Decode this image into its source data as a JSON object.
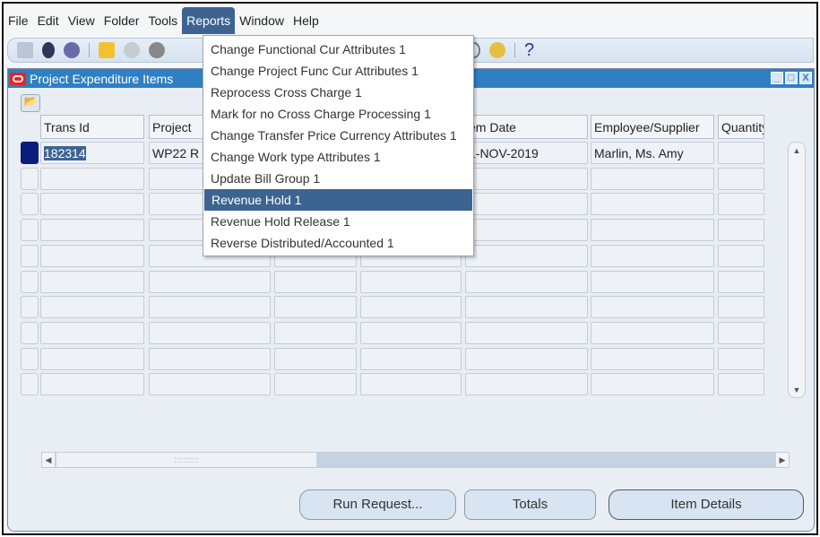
{
  "menubar": [
    "File",
    "Edit",
    "View",
    "Folder",
    "Tools",
    "Reports",
    "Window",
    "Help"
  ],
  "active_menu": "Reports",
  "toolbar": {
    "help_glyph": "?"
  },
  "window": {
    "title": "Project Expenditure Items",
    "controls": [
      "_",
      "□",
      "X"
    ]
  },
  "table": {
    "columns": [
      "Trans Id",
      "Project",
      "",
      "",
      "em Date",
      "Employee/Supplier",
      "Quantity"
    ],
    "rows": [
      [
        "182314",
        "WP22 R",
        "",
        "",
        "1-NOV-2019",
        "Marlin, Ms. Amy",
        ""
      ]
    ],
    "empty_rows": 9
  },
  "reports_menu": {
    "items": [
      "Change Functional Cur Attributes 1",
      "Change Project Func Cur Attributes 1",
      "Reprocess Cross Charge 1",
      "Mark for no Cross Charge Processing 1",
      "Change Transfer Price Currency Attributes 1",
      "Change Work type Attributes 1",
      "Update Bill Group 1",
      "Revenue Hold 1",
      "Revenue Hold Release 1",
      "Reverse Distributed/Accounted  1"
    ],
    "highlighted": "Revenue Hold 1"
  },
  "buttons": {
    "run_request": "Run Request...",
    "totals": "Totals",
    "item_details": "Item Details"
  }
}
